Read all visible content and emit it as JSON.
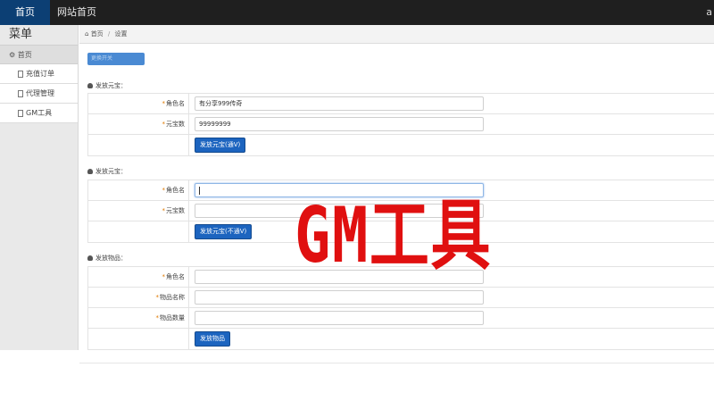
{
  "topbar": {
    "tabs": [
      {
        "label": "首页",
        "active": true
      },
      {
        "label": "网站首页",
        "active": false
      }
    ],
    "user_label": "a"
  },
  "sidebar": {
    "title": "菜单",
    "home_label": "首页",
    "items": [
      {
        "label": "充值订单",
        "icon": "document-icon"
      },
      {
        "label": "代理管理",
        "icon": "document-icon"
      },
      {
        "label": "GM工具",
        "icon": "document-icon"
      }
    ]
  },
  "breadcrumb": {
    "home": "首页",
    "separator": "/",
    "current": "设置"
  },
  "top_button": {
    "label": "更换开关"
  },
  "sections": [
    {
      "title": "发放元宝：",
      "fields": [
        {
          "label": "角色名",
          "value": "有分享999传奇",
          "required": true
        },
        {
          "label": "元宝数",
          "value": "99999999",
          "required": true
        }
      ],
      "button": "发放元宝(通V)"
    },
    {
      "title": "发放元宝：",
      "fields": [
        {
          "label": "角色名",
          "value": "",
          "required": true
        },
        {
          "label": "元宝数",
          "value": "",
          "required": true
        }
      ],
      "button": "发放元宝(不通V)"
    },
    {
      "title": "发放物品：",
      "fields": [
        {
          "label": "角色名",
          "value": "",
          "required": true
        },
        {
          "label": "物品名称",
          "value": "",
          "required": true
        },
        {
          "label": "物品数量",
          "value": "",
          "required": true
        }
      ],
      "button": "发放物品"
    }
  ],
  "overlay_text": "GM工具",
  "colors": {
    "topbar_bg": "#1f1f1f",
    "active_tab": "#0c3f74",
    "primary_button": "#1c64bf",
    "overlay": "#e01010",
    "required_star": "#e07a00"
  }
}
